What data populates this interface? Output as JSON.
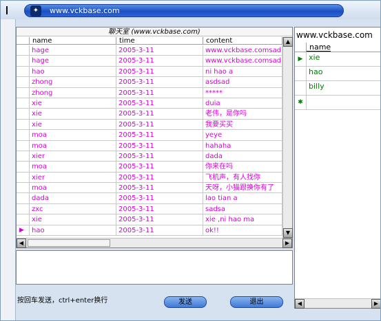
{
  "window": {
    "title": "www.vckbase.com"
  },
  "chat_grid": {
    "caption": "聊天室 (www.vckbase.com)",
    "columns": [
      "name",
      "time",
      "content"
    ],
    "rows": [
      {
        "indicator": "",
        "name": "hage",
        "time": "2005-3-11",
        "content": "www.vckbase.comsad"
      },
      {
        "indicator": "",
        "name": "hage",
        "time": "2005-3-11",
        "content": "www.vckbase.comsad"
      },
      {
        "indicator": "",
        "name": "hao",
        "time": "2005-3-11",
        "content": "ni hao a"
      },
      {
        "indicator": "",
        "name": "zhong",
        "time": "2005-3-11",
        "content": "asdsad"
      },
      {
        "indicator": "",
        "name": "zhong",
        "time": "2005-3-11",
        "content": "*****"
      },
      {
        "indicator": "",
        "name": "xie",
        "time": "2005-3-11",
        "content": "duia"
      },
      {
        "indicator": "",
        "name": "xie",
        "time": "2005-3-11",
        "content": "老伟，是你吗"
      },
      {
        "indicator": "",
        "name": "xie",
        "time": "2005-3-11",
        "content": "我要买买"
      },
      {
        "indicator": "",
        "name": "moa",
        "time": "2005-3-11",
        "content": "yeye"
      },
      {
        "indicator": "",
        "name": "moa",
        "time": "2005-3-11",
        "content": "hahaha"
      },
      {
        "indicator": "",
        "name": "xier",
        "time": "2005-3-11",
        "content": "dada"
      },
      {
        "indicator": "",
        "name": "moa",
        "time": "2005-3-11",
        "content": "你来在吗"
      },
      {
        "indicator": "",
        "name": "xier",
        "time": "2005-3-11",
        "content": "飞机声，有人找你"
      },
      {
        "indicator": "",
        "name": "moa",
        "time": "2005-3-11",
        "content": "天呀，小猫跟换你有了"
      },
      {
        "indicator": "",
        "name": "dada",
        "time": "2005-3-11",
        "content": "lao tian a"
      },
      {
        "indicator": "",
        "name": "zxc",
        "time": "2005-3-11",
        "content": "sadsa"
      },
      {
        "indicator": "",
        "name": "xie",
        "time": "2005-3-11",
        "content": "xie ,ni hao ma"
      },
      {
        "indicator": "▶",
        "name": "hao",
        "time": "2005-3-11",
        "content": "ok!!"
      }
    ]
  },
  "message_input": {
    "value": ""
  },
  "hint": "按回车发送，ctrl+enter换行",
  "buttons": {
    "send": "发送",
    "exit": "退出"
  },
  "user_panel": {
    "title": "www.vckbase.com",
    "column": "name",
    "users": [
      {
        "indicator": "▶",
        "name": "xie"
      },
      {
        "indicator": "",
        "name": "hao"
      },
      {
        "indicator": "",
        "name": "billy"
      },
      {
        "indicator": "✱",
        "name": ""
      }
    ]
  },
  "colors": {
    "chat_text": "#d400d4",
    "user_text": "#008000",
    "title_bar": "#1a4fc4"
  },
  "icons": {
    "app": "app-icon",
    "scroll_up": "arrow-up-icon",
    "scroll_down": "arrow-down-icon",
    "scroll_left": "arrow-left-icon",
    "scroll_right": "arrow-right-icon"
  }
}
